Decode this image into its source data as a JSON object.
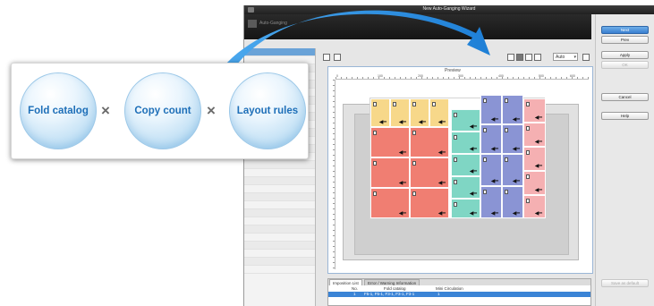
{
  "window": {
    "title": "New Auto-Ganging Wizard",
    "header_text": "Auto-Ganging"
  },
  "toolbar": {
    "zoom_value": "Auto"
  },
  "preview": {
    "label": "Preview",
    "ruler_numbers": [
      "0",
      "100",
      "200",
      "300",
      "400",
      "500",
      "600"
    ]
  },
  "buttons": {
    "next": "Next",
    "prev": "Prev",
    "apply": "Apply",
    "ok": "OK",
    "cancel": "Cancel",
    "help": "Help",
    "save_default": "Save as default"
  },
  "bottom": {
    "tabs": [
      "Imposition List",
      "Error / Warning Information"
    ],
    "columns": [
      "No.",
      "Fold catalog",
      "Mini Circulation"
    ],
    "rows": [
      [
        "1",
        "F5-1, F5-1, F3-1, F3-1, F3-1",
        "1"
      ]
    ]
  },
  "callout": {
    "items": [
      "Fold catalog",
      "Copy count",
      "Layout rules"
    ],
    "operator": "×"
  },
  "colors": {
    "accent": "#2f86dd",
    "bubble_text": "#1e6fb8",
    "cell_yellow": "#f7d88a",
    "cell_red": "#f07e72",
    "cell_teal": "#7fd6c4",
    "cell_blue": "#8a94d4",
    "cell_pink": "#f5b0b2"
  }
}
